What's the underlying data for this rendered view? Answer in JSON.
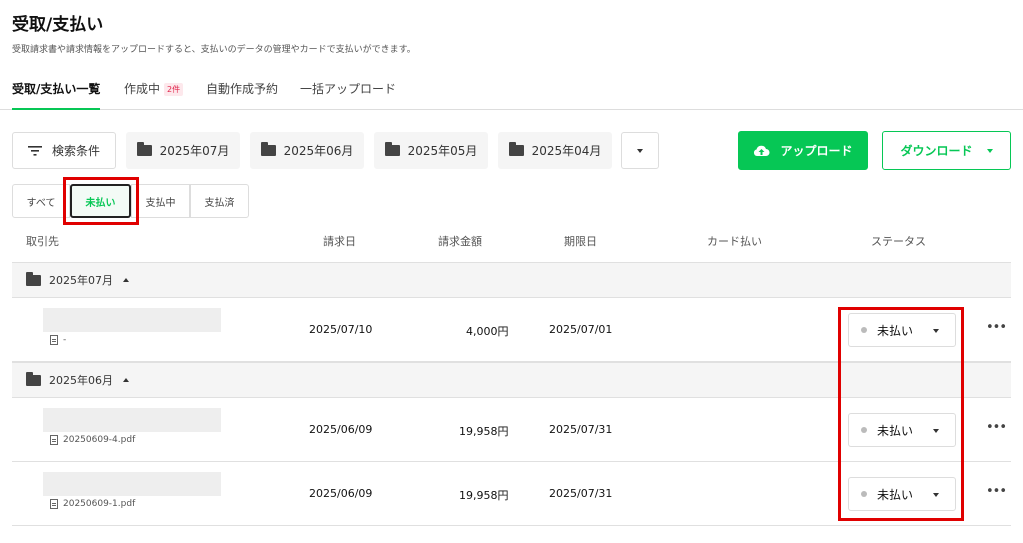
{
  "page": {
    "title": "受取/支払い",
    "description": "受取請求書や請求情報をアップロードすると、支払いのデータの管理やカードで支払いができます。"
  },
  "tabs": [
    {
      "label": "受取/支払い一覧",
      "active": true
    },
    {
      "label": "作成中",
      "badge": "2件"
    },
    {
      "label": "自動作成予約"
    },
    {
      "label": "一括アップロード"
    }
  ],
  "toolbar": {
    "filter_label": "検索条件",
    "months": [
      "2025年07月",
      "2025年06月",
      "2025年05月",
      "2025年04月"
    ],
    "upload_label": "アップロード",
    "download_label": "ダウンロード"
  },
  "status_filter": {
    "options": [
      "すべて",
      "未払い",
      "支払中",
      "支払済"
    ],
    "selected": "未払い"
  },
  "table": {
    "headers": [
      "取引先",
      "請求日",
      "請求金額",
      "期限日",
      "カード払い",
      "ステータス"
    ],
    "groups": [
      {
        "label": "2025年07月",
        "rows": [
          {
            "file": "-",
            "invoice_date": "2025/07/10",
            "amount": "4,000円",
            "due_date": "2025/07/01",
            "status": "未払い"
          }
        ]
      },
      {
        "label": "2025年06月",
        "rows": [
          {
            "file": "20250609-4.pdf",
            "invoice_date": "2025/06/09",
            "amount": "19,958円",
            "due_date": "2025/07/31",
            "status": "未払い"
          },
          {
            "file": "20250609-1.pdf",
            "invoice_date": "2025/06/09",
            "amount": "19,958円",
            "due_date": "2025/07/31",
            "status": "未払い"
          }
        ]
      }
    ]
  },
  "colors": {
    "accent": "#06c755",
    "highlight": "#e00000",
    "badge": "#e0244b"
  }
}
